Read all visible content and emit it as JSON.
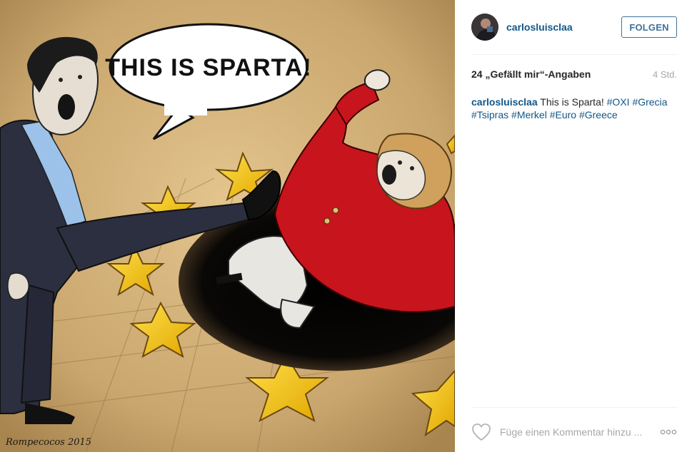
{
  "post": {
    "image": {
      "speech_bubble_text": "THIS IS SPARTA!",
      "signature": "Rompecocos 2015"
    },
    "header": {
      "username": "carlosluisclaa",
      "follow_label": "FOLGEN"
    },
    "stats": {
      "likes_text": "24 „Gefällt mir“-Angaben",
      "timestamp": "4 Std."
    },
    "caption": {
      "username": "carlosluisclaa",
      "text": "This is Sparta!",
      "hashtags": [
        "#OXI",
        "#Grecia",
        "#Tsipras",
        "#Merkel",
        "#Euro",
        "#Greece"
      ]
    },
    "comment": {
      "placeholder": "Füge einen Kommentar hinzu ..."
    },
    "icons": {
      "like": "heart-icon",
      "more": "more-options-icon"
    },
    "colors": {
      "link": "#125688",
      "follow": "#3f729b",
      "muted": "#a5a7aa",
      "divider": "#efefef",
      "star": "#f5c400",
      "jacket": "#c8141c",
      "background_tan": "#c9a66e"
    }
  }
}
